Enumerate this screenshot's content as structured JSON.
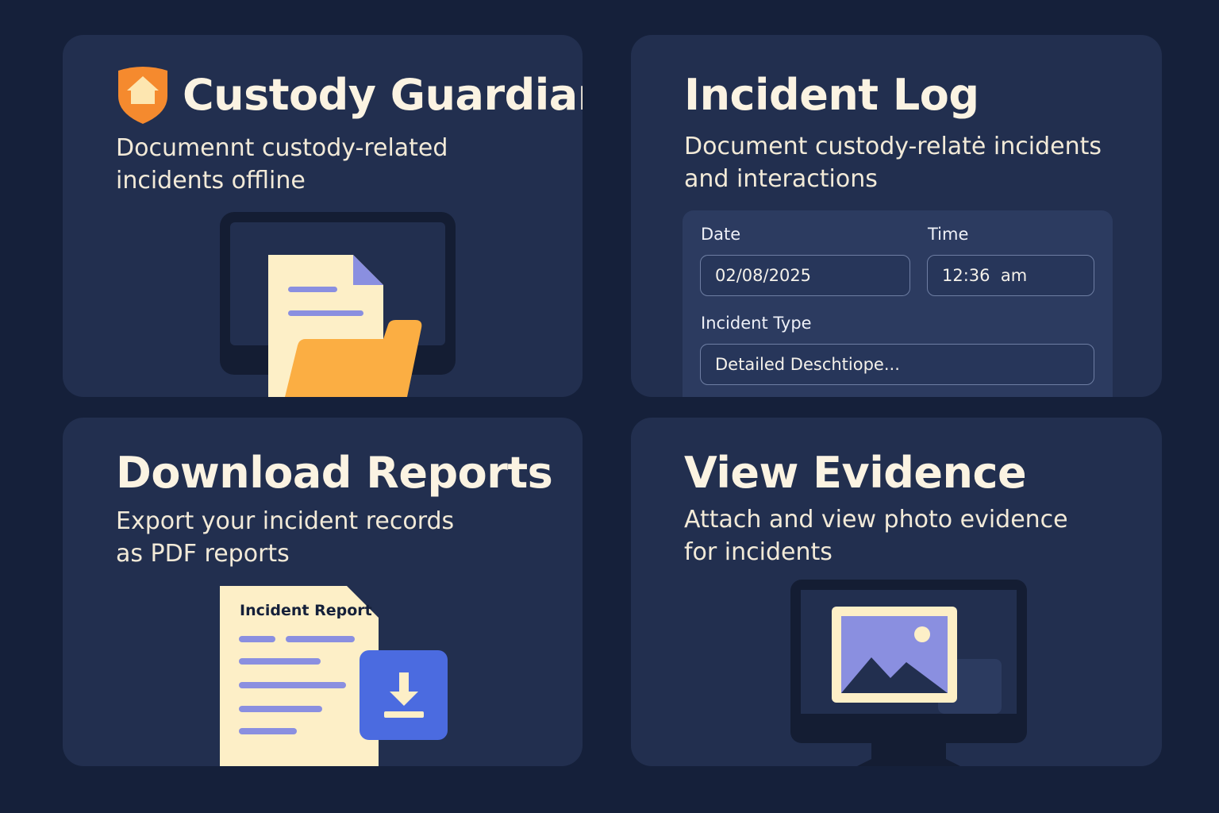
{
  "custody": {
    "title": "Custody Guardian",
    "subtitle": "Documennt custody-related\nincidents offline",
    "logo_icon": "shield-home-icon",
    "illustration_icon": "document-folder-icon"
  },
  "incident_log": {
    "title": "Incident Log",
    "subtitle": "Document custody-relatė incidents\nand interactions",
    "form": {
      "date_label": "Date",
      "date_value": "02/08/2025",
      "time_label": "Time",
      "time_value": "12:36  am",
      "type_label": "Incident Type",
      "type_value": "Detailed Deschtiope..."
    }
  },
  "download": {
    "title": "Download Reports",
    "subtitle": "Export your incident records\nas PDF reports",
    "report_doc_title": "Incident Report",
    "download_icon": "download-icon"
  },
  "evidence": {
    "title": "View Evidence",
    "subtitle": "Attach and view photo evidence\nfor incidents",
    "illustration_icon": "photo-monitor-icon"
  },
  "colors": {
    "background": "#15203a",
    "card": "#222f4f",
    "accent_orange": "#f58a2e",
    "folder_yellow": "#fbae43",
    "paper": "#fdefc7",
    "lavender": "#8a8fe0",
    "download_blue": "#4b6be0"
  }
}
